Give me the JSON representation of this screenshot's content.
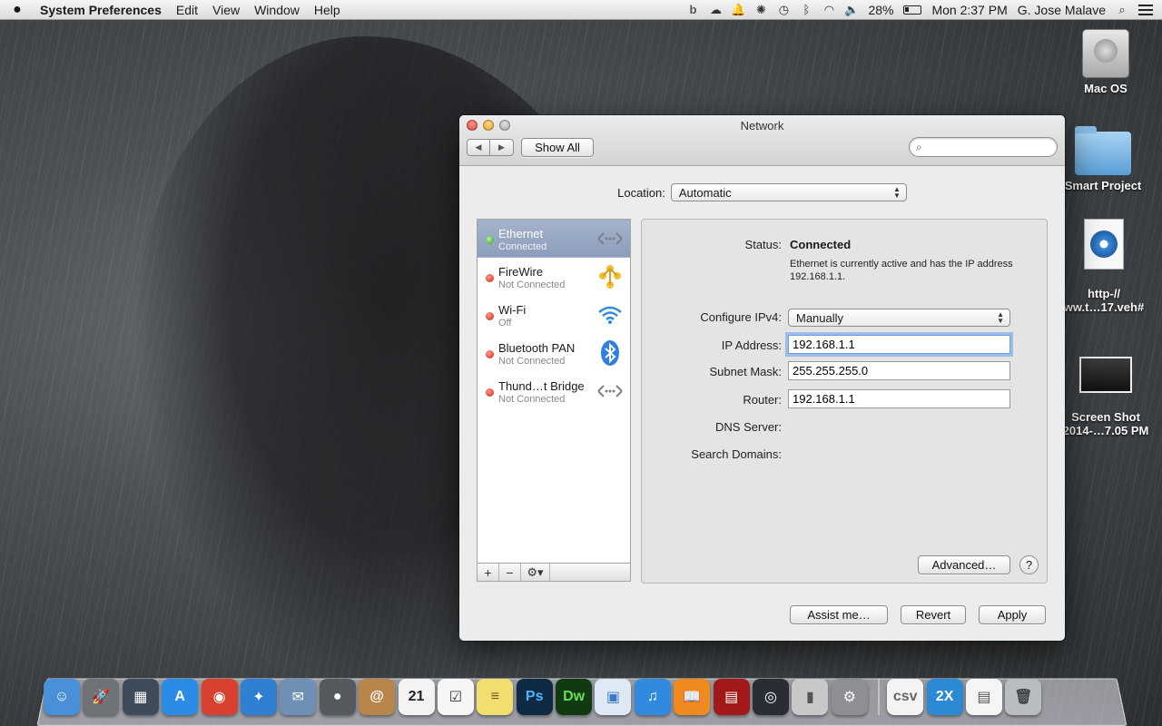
{
  "menubar": {
    "app_name": "System Preferences",
    "menus": [
      "Edit",
      "View",
      "Window",
      "Help"
    ],
    "battery": "28%",
    "clock": "Mon 2:37 PM",
    "user": "G. Jose Malave",
    "icons": [
      "b-icon",
      "creative-cloud-icon",
      "notification-bell-icon",
      "settings-wheel-icon",
      "time-machine-icon",
      "bluetooth-icon",
      "wifi-icon",
      "volume-icon",
      "battery-icon",
      "spotlight-search-icon",
      "notification-center-icon"
    ]
  },
  "desktop": {
    "icons": [
      {
        "label": "Mac OS",
        "type": "hard-drive"
      },
      {
        "label": "Smart Project",
        "type": "folder"
      },
      {
        "label": "http-//\nww.t…17.veh#",
        "type": "webloc"
      },
      {
        "label": "Screen Shot\n2014-…7.05 PM",
        "type": "screenshot"
      }
    ]
  },
  "window": {
    "title": "Network",
    "show_all": "Show All",
    "search_placeholder": "",
    "location_label": "Location:",
    "location_value": "Automatic",
    "services": [
      {
        "name": "Ethernet",
        "status": "Connected",
        "state": "green",
        "icon": "ethernet-icon",
        "selected": true
      },
      {
        "name": "FireWire",
        "status": "Not Connected",
        "state": "red",
        "icon": "firewire-icon",
        "selected": false
      },
      {
        "name": "Wi-Fi",
        "status": "Off",
        "state": "red",
        "icon": "wifi-icon",
        "selected": false
      },
      {
        "name": "Bluetooth PAN",
        "status": "Not Connected",
        "state": "red",
        "icon": "bluetooth-icon",
        "selected": false
      },
      {
        "name": "Thund…t Bridge",
        "status": "Not Connected",
        "state": "red",
        "icon": "thunderbolt-bridge-icon",
        "selected": false
      }
    ],
    "list_footer": {
      "add": "+",
      "remove": "−",
      "gear": "⚙▾"
    },
    "detail": {
      "status_label": "Status:",
      "status_value": "Connected",
      "status_desc": "Ethernet is currently active and has the IP address 192.168.1.1.",
      "configure_label": "Configure IPv4:",
      "configure_value": "Manually",
      "ip_label": "IP Address:",
      "ip_value": "192.168.1.1",
      "subnet_label": "Subnet Mask:",
      "subnet_value": "255.255.255.0",
      "router_label": "Router:",
      "router_value": "192.168.1.1",
      "dns_label": "DNS Server:",
      "search_domains_label": "Search Domains:",
      "advanced": "Advanced…",
      "help": "?"
    },
    "buttons": {
      "assist": "Assist me…",
      "revert": "Revert",
      "apply": "Apply"
    }
  },
  "dock": {
    "apps": [
      {
        "name": "finder-icon",
        "color": "#4a90d9",
        "glyph": "☺"
      },
      {
        "name": "launchpad-icon",
        "color": "#6f7378",
        "glyph": "🚀"
      },
      {
        "name": "mission-control-icon",
        "color": "#3d4b5a",
        "glyph": "▦"
      },
      {
        "name": "app-store-icon",
        "color": "#2a8ce6",
        "glyph": "A"
      },
      {
        "name": "chrome-icon",
        "color": "#d8402f",
        "glyph": "◉"
      },
      {
        "name": "safari-icon",
        "color": "#2f7fd3",
        "glyph": "✦"
      },
      {
        "name": "mail-icon",
        "color": "#6f8fb5",
        "glyph": "✉"
      },
      {
        "name": "facetime-icon",
        "color": "#56595d",
        "glyph": "●"
      },
      {
        "name": "contacts-icon",
        "color": "#b8864b",
        "glyph": "@"
      },
      {
        "name": "calendar-icon",
        "color": "#f3f3f3",
        "glyph": "21",
        "text_color": "#222"
      },
      {
        "name": "reminders-icon",
        "color": "#f6f6f6",
        "glyph": "☑",
        "text_color": "#333"
      },
      {
        "name": "notes-icon",
        "color": "#f2dd6f",
        "glyph": "≡",
        "text_color": "#6a5a20"
      },
      {
        "name": "photoshop-icon",
        "color": "#0f2a45",
        "glyph": "Ps",
        "text_color": "#4fb5ff"
      },
      {
        "name": "dreamweaver-icon",
        "color": "#123a12",
        "glyph": "Dw",
        "text_color": "#67e05a"
      },
      {
        "name": "preview-icon",
        "color": "#dfe9f5",
        "glyph": "▣",
        "text_color": "#3b7ac8"
      },
      {
        "name": "itunes-icon",
        "color": "#2f8ae0",
        "glyph": "♫"
      },
      {
        "name": "ibooks-icon",
        "color": "#f08a1f",
        "glyph": "📖"
      },
      {
        "name": "photo-booth-icon",
        "color": "#a2191a",
        "glyph": "▤"
      },
      {
        "name": "camera-icon",
        "color": "#2a2d33",
        "glyph": "◎"
      },
      {
        "name": "switch-icon",
        "color": "#c8c8c8",
        "glyph": "▮",
        "text_color": "#555"
      },
      {
        "name": "system-preferences-icon",
        "color": "#8d8f93",
        "glyph": "⚙"
      }
    ],
    "stacks": [
      {
        "name": "csv-document-icon",
        "color": "#f3f3f3",
        "glyph": "csv",
        "text_color": "#666"
      },
      {
        "name": "2x-client-icon",
        "color": "#2a8ad6",
        "glyph": "2X"
      },
      {
        "name": "document-stack-icon",
        "color": "#f5f5f5",
        "glyph": "▤",
        "text_color": "#555"
      },
      {
        "name": "trash-icon",
        "color": "#b9bcc0",
        "glyph": "🗑",
        "text_color": "#444"
      }
    ]
  }
}
